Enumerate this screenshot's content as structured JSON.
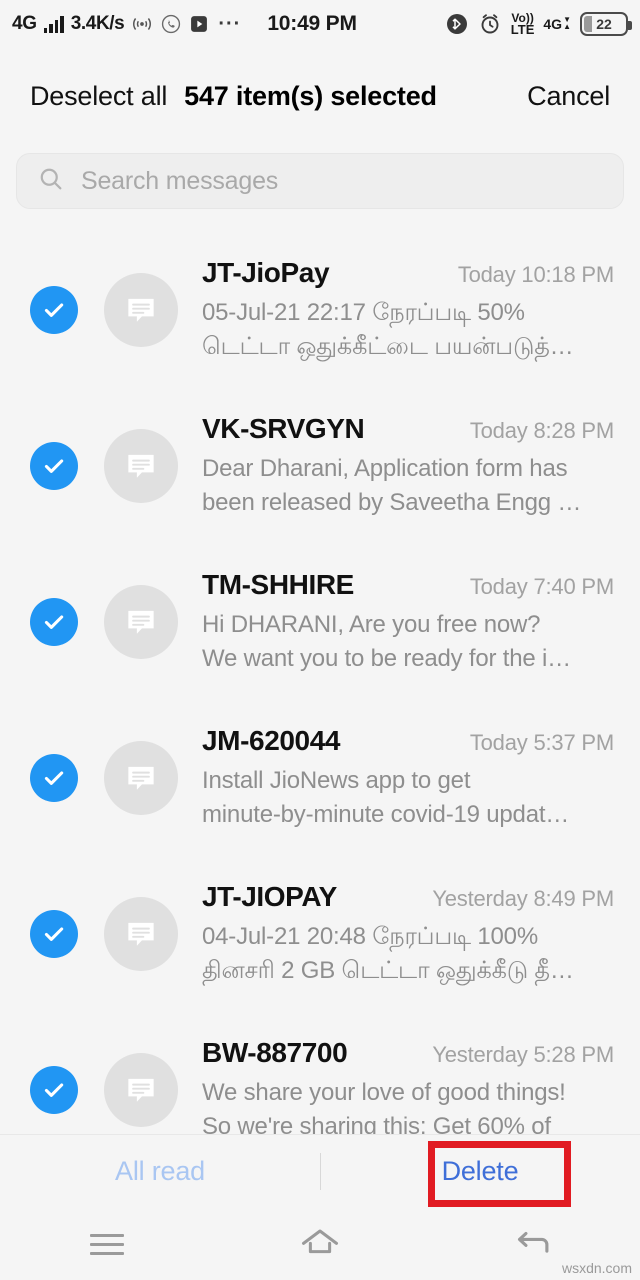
{
  "status_bar": {
    "network_label": "4G",
    "data_speed": "3.4K/s",
    "overflow_dots": "···",
    "time": "10:49 PM",
    "volte_top": "Vo))",
    "volte_bottom": "LTE",
    "net_right": "4G",
    "battery_percent": "22",
    "icons": [
      "signal-bars-icon",
      "hotspot-icon",
      "whatsapp-icon",
      "video-play-icon",
      "bluetooth-icon",
      "alarm-clock-icon",
      "volte-icon",
      "data-arrows-icon",
      "battery-icon"
    ]
  },
  "selection_bar": {
    "deselect_all": "Deselect all",
    "count_label": "547 item(s) selected",
    "cancel": "Cancel"
  },
  "search": {
    "placeholder": "Search messages",
    "value": ""
  },
  "messages": [
    {
      "sender": "JT-JioPay",
      "time": "Today 10:18 PM",
      "line1": "05-Jul-21 22:17 நேரப்படி 50%",
      "line2": "டெட்டா ஒதுக்கீட்டை பயன்படுத்…",
      "selected": true
    },
    {
      "sender": "VK-SRVGYN",
      "time": "Today 8:28 PM",
      "line1": "Dear Dharani, Application form has",
      "line2": "been released by Saveetha Engg …",
      "selected": true
    },
    {
      "sender": "TM-SHHIRE",
      "time": "Today 7:40 PM",
      "line1": "Hi DHARANI, Are you free now?",
      "line2": "We want you to be ready for the i…",
      "selected": true
    },
    {
      "sender": "JM-620044",
      "time": "Today 5:37 PM",
      "line1": "Install JioNews app to get",
      "line2": "minute-by-minute covid-19 updat…",
      "selected": true
    },
    {
      "sender": "JT-JIOPAY",
      "time": "Yesterday 8:49 PM",
      "line1": "04-Jul-21 20:48 நேரப்படி 100%",
      "line2": "தினசரி 2 GB டெட்டா ஒதுக்கீடு தீ…",
      "selected": true
    },
    {
      "sender": "BW-887700",
      "time": "Yesterday 5:28 PM",
      "line1": "We share your love of good things!",
      "line2": "So we're sharing this: Get 60% of",
      "selected": true
    }
  ],
  "action_bar": {
    "all_read": "All read",
    "delete": "Delete"
  },
  "nav_bar": {
    "menu": "menu-icon",
    "home": "home-icon",
    "back": "back-icon"
  },
  "watermark": "wsxdn.com",
  "colors": {
    "accent_blue": "#2196f3",
    "delete_blue": "#3f6fd8",
    "disabled_blue": "#a9c6f2",
    "annotation_red": "#e11b22",
    "background": "#f5f5f5"
  }
}
